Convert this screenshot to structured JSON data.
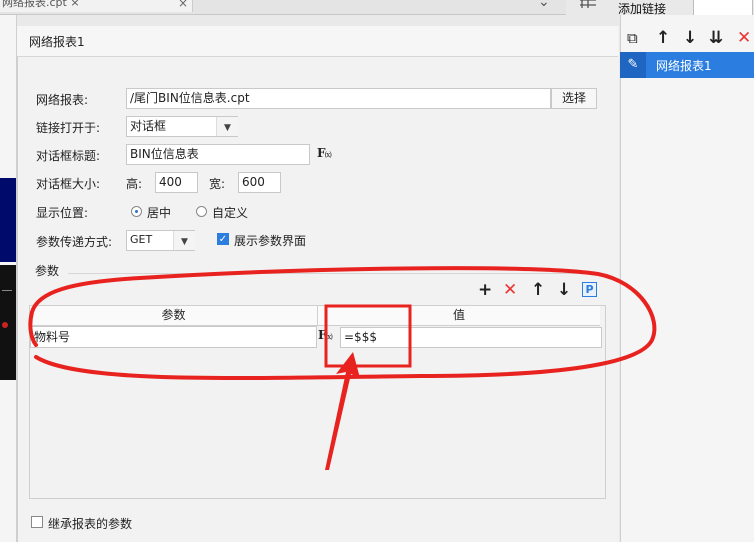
{
  "top_tab": {
    "label": "网络报表.cpt ×",
    "close": "×",
    "menu_glyph": "⌄"
  },
  "right_panel": {
    "title": "添加链接",
    "toolbar": {
      "copy": "⧉",
      "up": "↑",
      "down": "↓",
      "sort": "⇊",
      "delete": "✕"
    },
    "items": [
      {
        "label": "网络报表1",
        "icon": "edit-icon"
      }
    ]
  },
  "dialog": {
    "title": "网络报表1",
    "report": {
      "label": "网络报表:",
      "value": "/尾门BIN位信息表.cpt",
      "button": "选择"
    },
    "open_in": {
      "label": "链接打开于:",
      "value": "对话框"
    },
    "dialog_title": {
      "label": "对话框标题:",
      "value": "BIN位信息表",
      "fx": "F"
    },
    "dialog_size": {
      "label": "对话框大小:",
      "height_label": "高:",
      "height": "400",
      "width_label": "宽:",
      "width": "600"
    },
    "position": {
      "label": "显示位置:",
      "options": [
        {
          "label": "居中",
          "checked": true
        },
        {
          "label": "自定义",
          "checked": false
        }
      ]
    },
    "method": {
      "label": "参数传递方式:",
      "value": "GET",
      "show_param_ui": {
        "label": "展示参数界面",
        "checked": true
      }
    },
    "params": {
      "section_label": "参数",
      "toolbar": {
        "add": "+",
        "delete": "✕",
        "up": "↑",
        "down": "↓",
        "p": "P"
      },
      "columns": [
        "参数",
        "值"
      ],
      "rows": [
        {
          "name": "物料号",
          "value": "=$$$"
        }
      ]
    },
    "inherit": {
      "label": "继承报表的参数",
      "checked": false
    }
  },
  "colors": {
    "accent": "#2b7de0",
    "annotation": "#e8231f"
  }
}
